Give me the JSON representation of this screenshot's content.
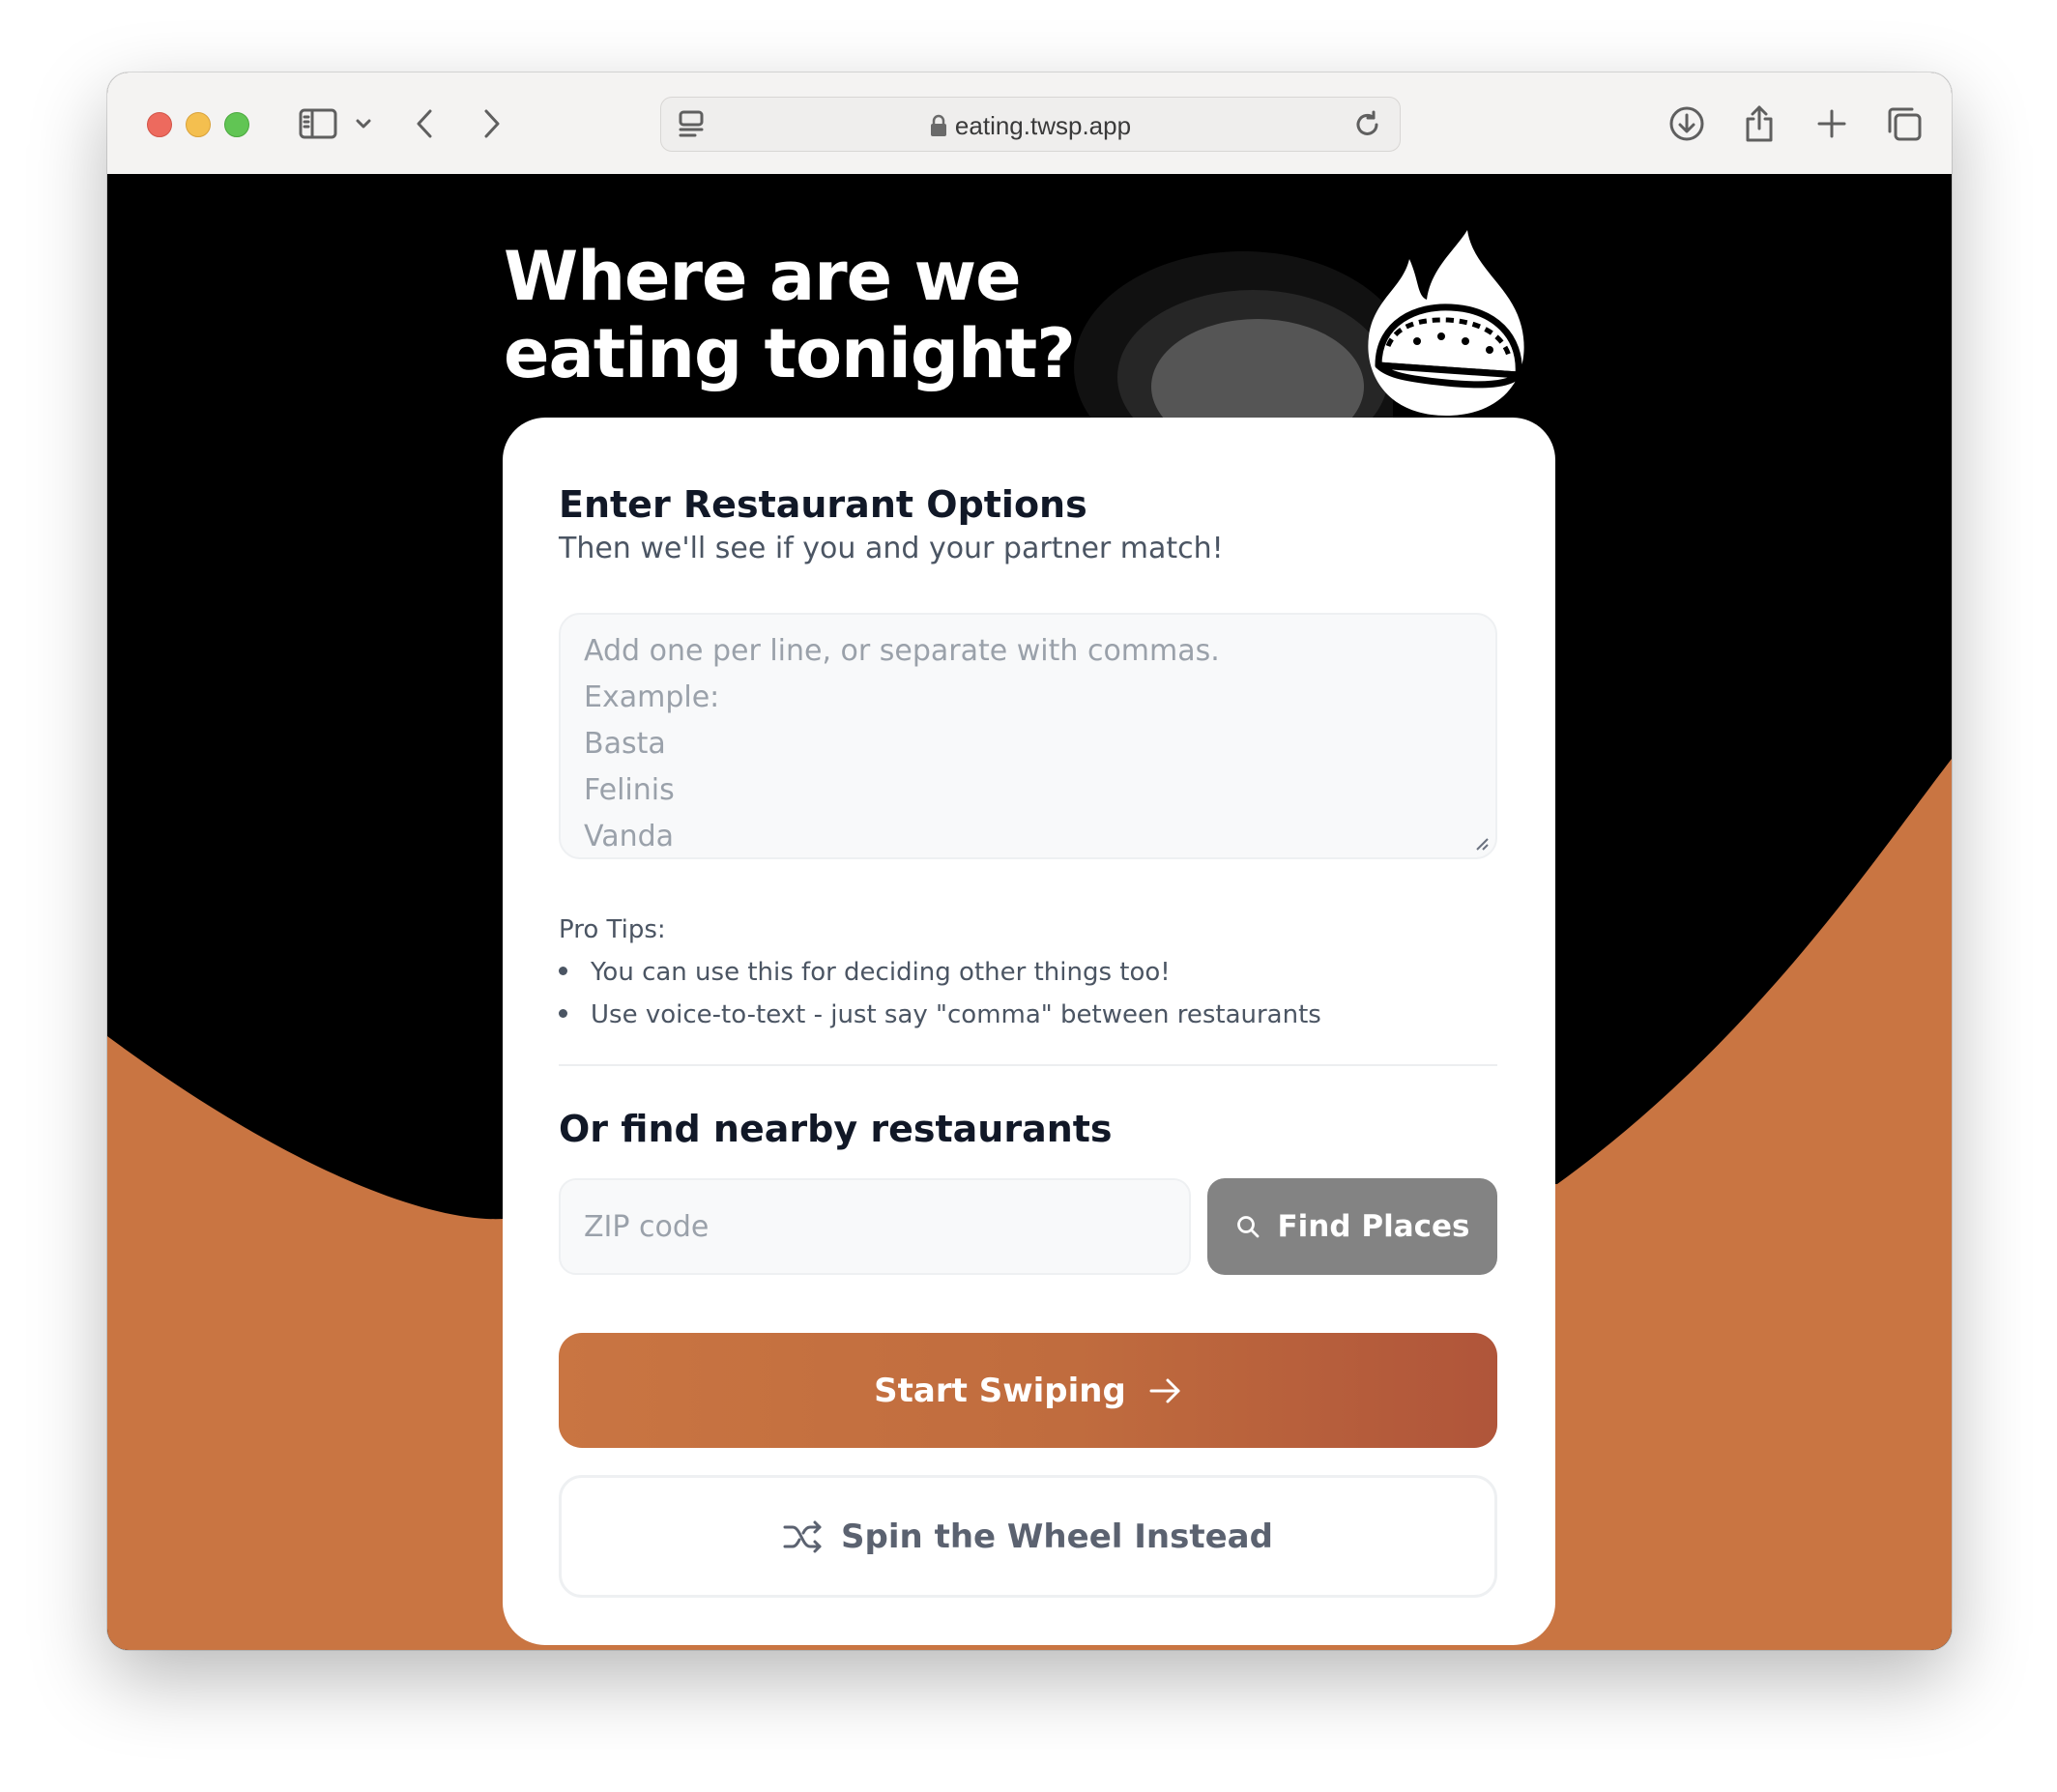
{
  "browser": {
    "url": "eating.twsp.app",
    "icons": [
      "sidebar-icon",
      "chevron-down-icon",
      "back-icon",
      "forward-icon",
      "page-menu-icon",
      "lock-icon",
      "reload-icon",
      "download-icon",
      "share-icon",
      "new-tab-icon",
      "tabs-overview-icon"
    ]
  },
  "hero": {
    "title_line1": "Where are we",
    "title_line2": "eating tonight?"
  },
  "card": {
    "heading": "Enter Restaurant Options",
    "subheading": "Then we'll see if you and your partner match!",
    "textarea_placeholder": [
      "Add one per line, or separate with commas.",
      "Example:",
      "Basta",
      "Felinis",
      "Vanda"
    ],
    "tips_label": "Pro Tips:",
    "tips": [
      "You can use this for deciding other things too!",
      "Use voice-to-text - just say \"comma\" between restaurants"
    ],
    "nearby_heading": "Or find nearby restaurants",
    "zip_placeholder": "ZIP code",
    "find_button": "Find Places",
    "start_button": "Start Swiping",
    "spin_button": "Spin the Wheel Instead"
  },
  "colors": {
    "accent": "#c97542",
    "accent_dark": "#b0553a",
    "background": "#000000",
    "find_button_bg": "#838383",
    "heading_text": "#111827"
  }
}
